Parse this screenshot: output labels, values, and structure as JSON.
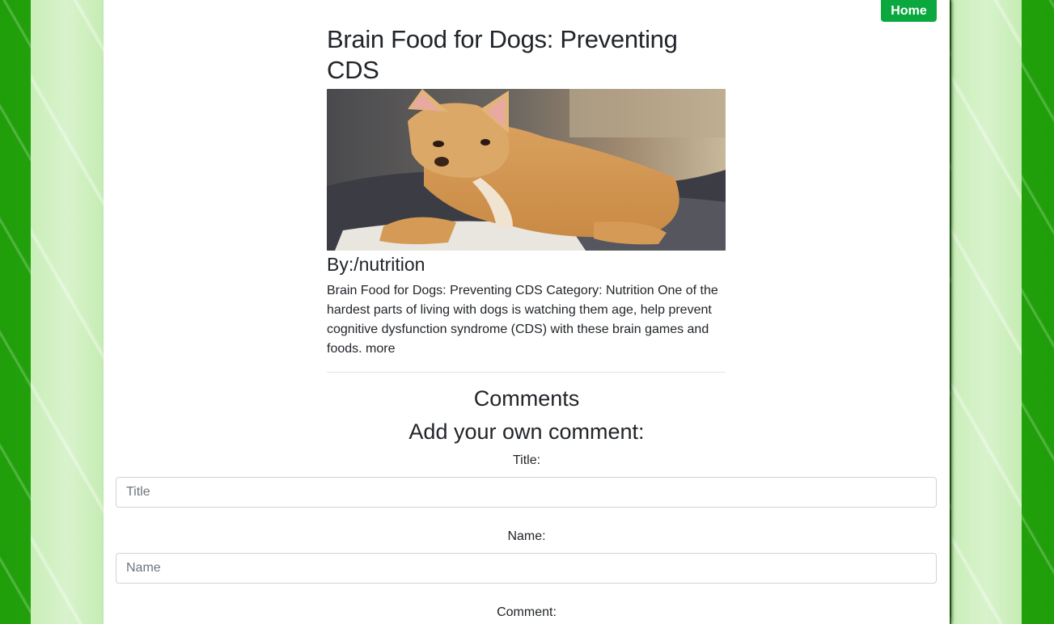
{
  "nav": {
    "home_label": "Home"
  },
  "article": {
    "title": "Brain Food for Dogs: Preventing CDS",
    "image_alt": "Chihuahua lying on a blanket",
    "byline": "By:/nutrition",
    "summary": "Brain Food for Dogs: Preventing CDS Category: Nutrition One of the hardest parts of living with dogs is watching them age, help prevent cognitive dysfunction syndrome (CDS) with these brain games and foods. ",
    "more_label": "more"
  },
  "comments": {
    "heading": "Comments",
    "add_heading": "Add your own comment:",
    "title_label": "Title:",
    "title_placeholder": "Title",
    "title_value": "",
    "name_label": "Name:",
    "name_placeholder": "Name",
    "name_value": "",
    "comment_label": "Comment:"
  },
  "colors": {
    "home_button": "#0aa83f",
    "background_green": "#44b318",
    "background_pale": "#d8f3cc"
  }
}
